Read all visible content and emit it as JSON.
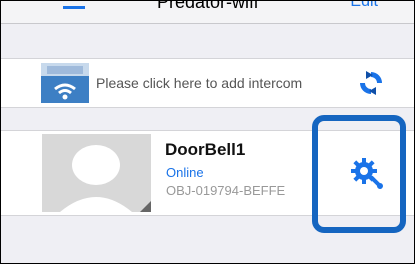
{
  "navbar": {
    "title": "Predator-wifi",
    "edit_label": "Edit"
  },
  "intercom_row": {
    "label": "Please click here to add intercom"
  },
  "device": {
    "name": "DoorBell1",
    "status": "Online",
    "id": "OBJ-019794-BEFFE"
  },
  "icons": {
    "menu": "menu-icon",
    "intercom": "intercom-icon",
    "refresh": "refresh-icon",
    "avatar": "avatar-placeholder",
    "settings": "gear-icon"
  },
  "colors": {
    "accent": "#1a73e8",
    "highlight": "#1565c0",
    "background": "#efeff4"
  }
}
